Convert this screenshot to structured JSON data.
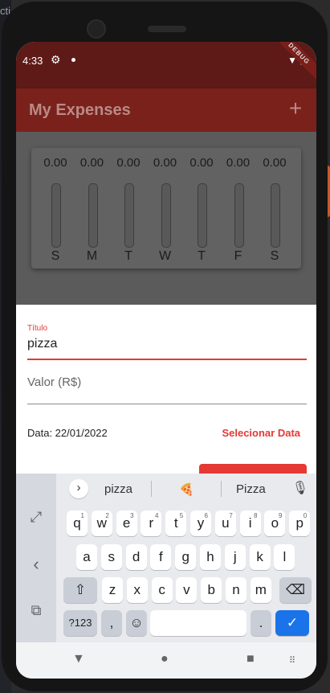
{
  "status": {
    "time": "4:33",
    "debug_label": "DEBUG"
  },
  "app": {
    "title": "My Expenses",
    "add_icon": "+"
  },
  "chart_data": {
    "type": "bar",
    "categories": [
      "S",
      "M",
      "T",
      "W",
      "T",
      "F",
      "S"
    ],
    "values": [
      0.0,
      0.0,
      0.0,
      0.0,
      0.0,
      0.0,
      0.0
    ],
    "amount_labels": [
      "0.00",
      "0.00",
      "0.00",
      "0.00",
      "0.00",
      "0.00",
      "0.00"
    ],
    "title": "",
    "xlabel": "",
    "ylabel": "",
    "colors": {
      "fill": "#7a211c",
      "track": "#595959"
    }
  },
  "form": {
    "title_label": "Título",
    "title_value": "pizza",
    "value_placeholder": "Valor (R$)",
    "date_text": "Data: 22/01/2022",
    "select_date": "Selecionar Data"
  },
  "keyboard": {
    "suggestions": [
      "pizza",
      "🍕",
      "Pizza"
    ],
    "row1": [
      {
        "k": "q",
        "h": "1"
      },
      {
        "k": "w",
        "h": "2"
      },
      {
        "k": "e",
        "h": "3"
      },
      {
        "k": "r",
        "h": "4"
      },
      {
        "k": "t",
        "h": "5"
      },
      {
        "k": "y",
        "h": "6"
      },
      {
        "k": "u",
        "h": "7"
      },
      {
        "k": "i",
        "h": "8"
      },
      {
        "k": "o",
        "h": "9"
      },
      {
        "k": "p",
        "h": "0"
      }
    ],
    "row2": [
      "a",
      "s",
      "d",
      "f",
      "g",
      "h",
      "j",
      "k",
      "l"
    ],
    "row3": [
      "z",
      "x",
      "c",
      "v",
      "b",
      "n",
      "m"
    ],
    "symbols_key": "?123",
    "comma_key": ",",
    "period_key": "."
  },
  "colors": {
    "accent": "#e53935",
    "primary": "#7a211c",
    "enter": "#1a73e8"
  }
}
